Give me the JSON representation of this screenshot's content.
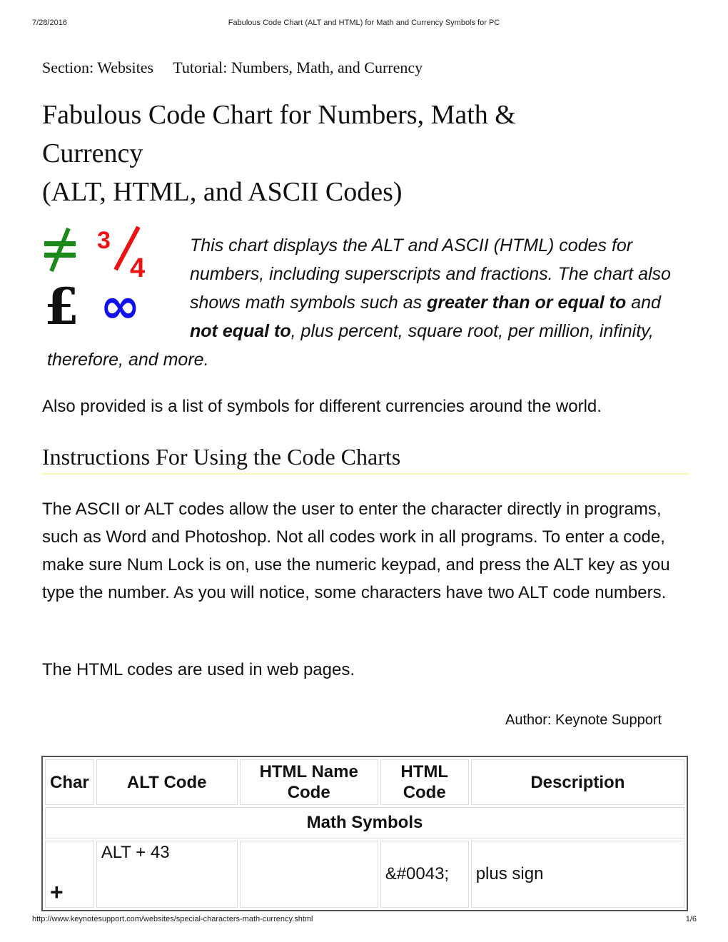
{
  "print_header": {
    "date": "7/28/2016",
    "title": "Fabulous Code Chart (ALT and HTML) for Math and Currency Symbols for PC"
  },
  "print_footer": {
    "url": "http://www.keynotesupport.com/websites/special-characters-math-currency.shtml",
    "page": "1/6"
  },
  "breadcrumb": {
    "section": "Section: Websites",
    "tutorial": "Tutorial: Numbers, Math, and Currency"
  },
  "title": {
    "line1": "Fabulous Code Chart for Numbers, Math &",
    "line2": "Currency",
    "line3": "(ALT, HTML, and ASCII Codes)"
  },
  "logo": {
    "symbols": [
      "≠",
      "3⁄4",
      "£",
      "∞"
    ],
    "colors": [
      "#1a8a1a",
      "#ee1111",
      "#111111",
      "#1111ee"
    ]
  },
  "intro": {
    "part1": "This chart displays the ALT and ASCII (HTML) codes for numbers, including superscripts and fractions. The chart also shows math symbols such as ",
    "bold1": "greater than or equal to",
    "part2": " and ",
    "bold2": "not equal to",
    "part3": ", plus percent, square root, per million, infinity, therefore, and more."
  },
  "also_provided": "Also provided is a list of symbols for different currencies around the world.",
  "instructions": {
    "heading": "Instructions For Using the Code Charts",
    "paragraph1": "The ASCII or ALT codes allow the user to enter the character directly in programs, such as Word and Photoshop. Not all codes work in all programs. To enter a code, make sure Num Lock is on, use the numeric keypad, and press the ALT key as you type the number. As you will notice, some characters have two ALT code numbers.",
    "paragraph2": "The HTML codes are used in web pages."
  },
  "author": "Author: Keynote Support",
  "table": {
    "headers": [
      "Char",
      "ALT Code",
      "HTML Name Code",
      "HTML Code",
      "Description"
    ],
    "groups": [
      {
        "label": "Math Symbols",
        "rows": [
          {
            "char": "+",
            "alt": "ALT + 43",
            "name_code": "",
            "html_code": "&#0043;",
            "description": "plus sign"
          }
        ]
      }
    ]
  }
}
